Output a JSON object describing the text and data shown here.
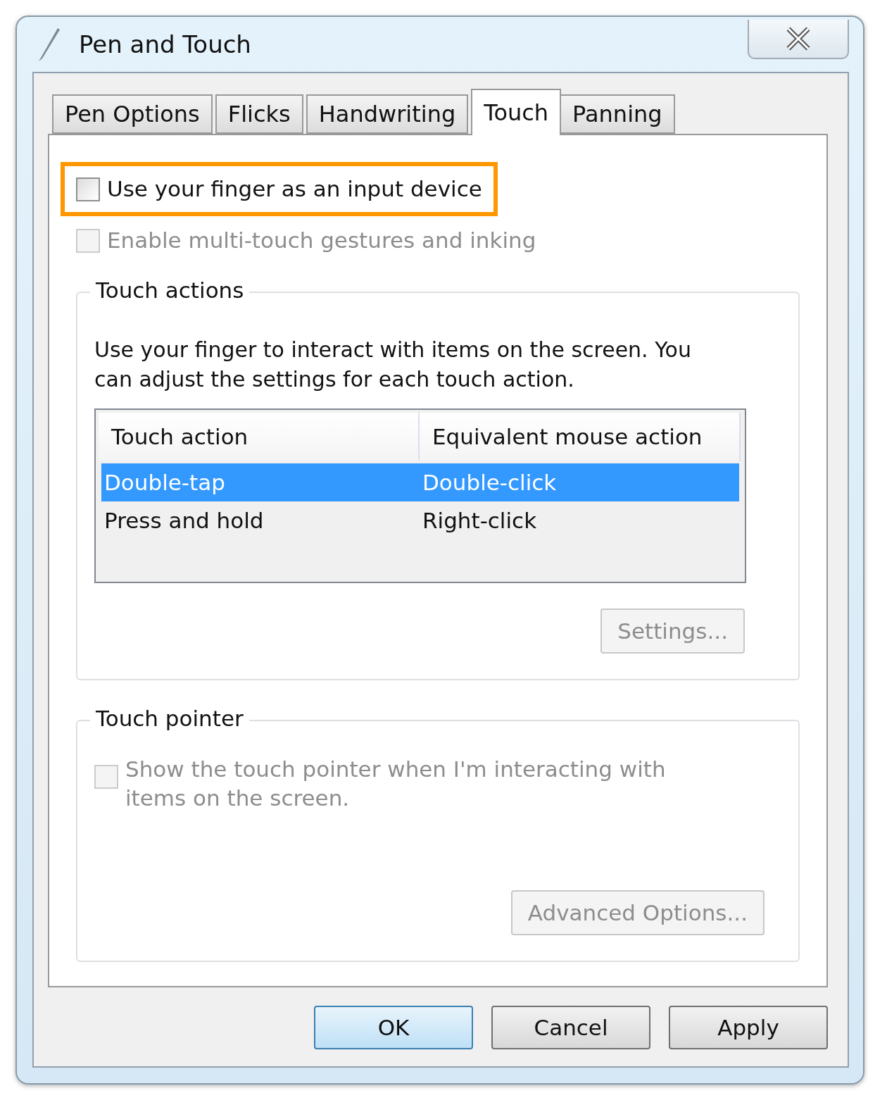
{
  "window": {
    "title": "Pen and Touch"
  },
  "tabs": [
    {
      "label": "Pen Options",
      "selected": false
    },
    {
      "label": "Flicks",
      "selected": false
    },
    {
      "label": "Handwriting",
      "selected": false
    },
    {
      "label": "Touch",
      "selected": true
    },
    {
      "label": "Panning",
      "selected": false
    }
  ],
  "options": [
    {
      "label": "Use your finger as an input device",
      "checked": false,
      "disabled": false,
      "highlighted": true
    },
    {
      "label": "Enable multi-touch gestures and inking",
      "checked": false,
      "disabled": true,
      "highlighted": false
    }
  ],
  "touch_actions": {
    "title": "Touch actions",
    "description": "Use your finger to interact with items on the screen. You can adjust the settings for each touch action.",
    "columns": [
      "Touch action",
      "Equivalent mouse action"
    ],
    "rows": [
      {
        "cells": [
          "Double-tap",
          "Double-click"
        ],
        "selected": true
      },
      {
        "cells": [
          "Press and hold",
          "Right-click"
        ],
        "selected": false
      }
    ],
    "button": {
      "label": "Settings...",
      "disabled": true
    }
  },
  "touch_pointer": {
    "title": "Touch pointer",
    "option": {
      "label": "Show the touch pointer when I'm interacting with items on the screen.",
      "checked": false,
      "disabled": true
    },
    "button": {
      "label": "Advanced Options...",
      "disabled": true
    }
  },
  "buttons": [
    {
      "label": "OK",
      "default": true
    },
    {
      "label": "Cancel",
      "default": false
    },
    {
      "label": "Apply",
      "default": false
    }
  ]
}
